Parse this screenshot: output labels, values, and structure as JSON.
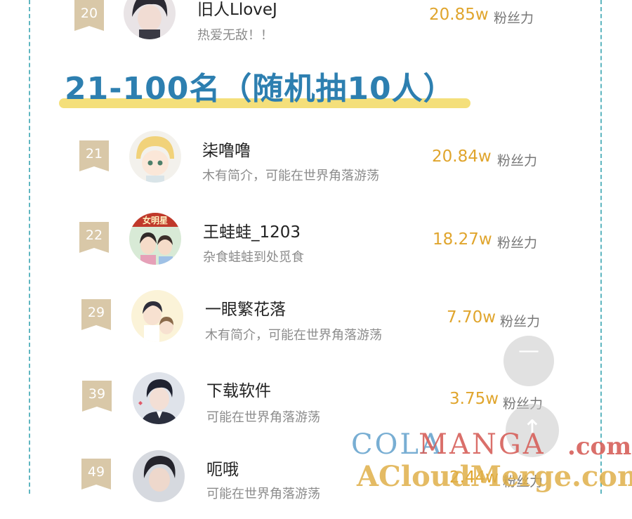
{
  "section_title": "21-100名（随机抽10人）",
  "fans_label": "粉丝力",
  "rows": [
    {
      "rank": "20",
      "name": "旧人LloveJ",
      "bio": "热爱无敌！！",
      "fans": "20.85w"
    },
    {
      "rank": "21",
      "name": "柒噜噜",
      "bio": "木有简介，可能在世界角落游荡",
      "fans": "20.84w"
    },
    {
      "rank": "22",
      "name": "王蛙蛙_1203",
      "bio": "杂食蛙蛙到处觅食",
      "fans": "18.27w"
    },
    {
      "rank": "29",
      "name": "一眼繁花落",
      "bio": "木有简介，可能在世界角落游荡",
      "fans": "7.70w"
    },
    {
      "rank": "39",
      "name": "下载软件",
      "bio": "可能在世界角落游荡",
      "fans": "3.75w"
    },
    {
      "rank": "49",
      "name": "呃哦",
      "bio": "可能在世界角落游荡",
      "fans": "2.44w"
    }
  ],
  "avatar22_text": "女明星",
  "fab_minus": "—",
  "fab_up": "↑",
  "watermark": {
    "cola": "COLA",
    "manga": "MANGA",
    "com": ".com",
    "acloud": "ACloudMerge.com"
  },
  "colors": {
    "frame": "#5fb6c0",
    "title": "#2d7fb0",
    "fans": "#e0a52d",
    "badge": "#d9c8a8",
    "underline": "#f4df7a"
  },
  "icons": [
    "avatar-dark-hair-icon",
    "avatar-blonde-chibi-icon",
    "avatar-actress-icon",
    "avatar-couple-icon",
    "avatar-suit-man-icon",
    "avatar-dark-man-icon",
    "minus-icon",
    "arrow-up-icon"
  ]
}
